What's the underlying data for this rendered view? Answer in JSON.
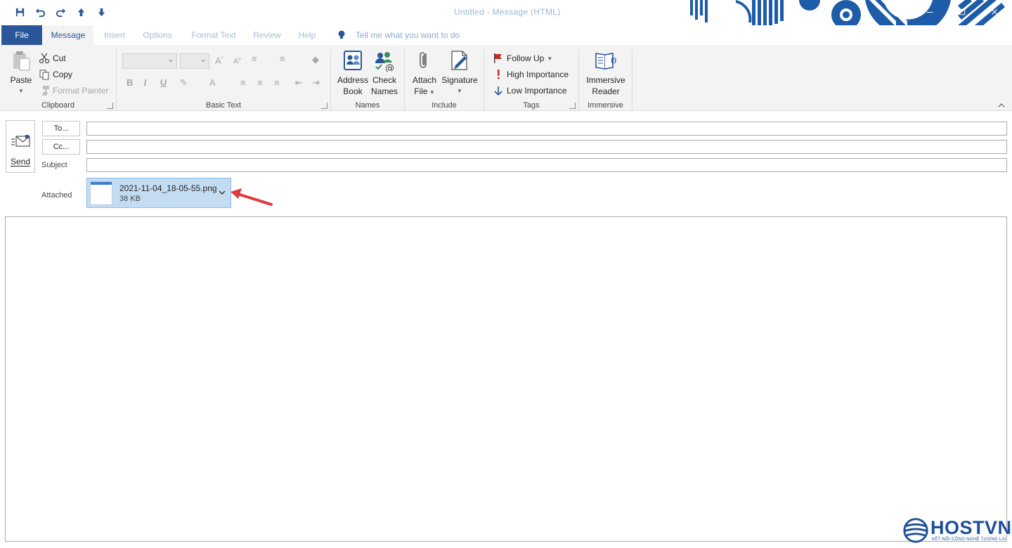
{
  "window": {
    "title": "Untitled - Message (HTML)"
  },
  "tabs": {
    "file": "File",
    "message": "Message",
    "insert": "Insert",
    "options": "Options",
    "format_text": "Format Text",
    "review": "Review",
    "help": "Help",
    "tell_me": "Tell me what you want to do"
  },
  "ribbon": {
    "clipboard": {
      "label": "Clipboard",
      "paste": "Paste",
      "cut": "Cut",
      "copy": "Copy",
      "format_painter": "Format Painter"
    },
    "basic_text": {
      "label": "Basic Text",
      "bold": "B",
      "italic": "I",
      "underline": "U",
      "font_color": "A"
    },
    "names": {
      "label": "Names",
      "address_book_1": "Address",
      "address_book_2": "Book",
      "check_names_1": "Check",
      "check_names_2": "Names"
    },
    "include": {
      "label": "Include",
      "attach_file_1": "Attach",
      "attach_file_2": "File",
      "signature": "Signature"
    },
    "tags": {
      "label": "Tags",
      "follow_up": "Follow Up",
      "high_importance": "High Importance",
      "low_importance": "Low Importance"
    },
    "immersive": {
      "label": "Immersive",
      "reader_1": "Immersive",
      "reader_2": "Reader"
    }
  },
  "compose": {
    "send": "Send",
    "to_button": "To...",
    "cc_button": "Cc...",
    "subject_label": "Subject",
    "attached_label": "Attached",
    "to_value": "",
    "cc_value": "",
    "subject_value": ""
  },
  "attachment": {
    "filename": "2021-11-04_18-05-55.png",
    "size": "38 KB"
  },
  "watermark": {
    "brand": "HOSTVN",
    "tagline": "KẾT NỐI CÔNG NGHỆ TƯƠNG LAI"
  },
  "colors": {
    "accent": "#2b579a",
    "attachment_bg": "#c4dcf2",
    "arrow": "#e0393e",
    "importance_high": "#c42b1c",
    "logo": "#1e4f9c"
  }
}
